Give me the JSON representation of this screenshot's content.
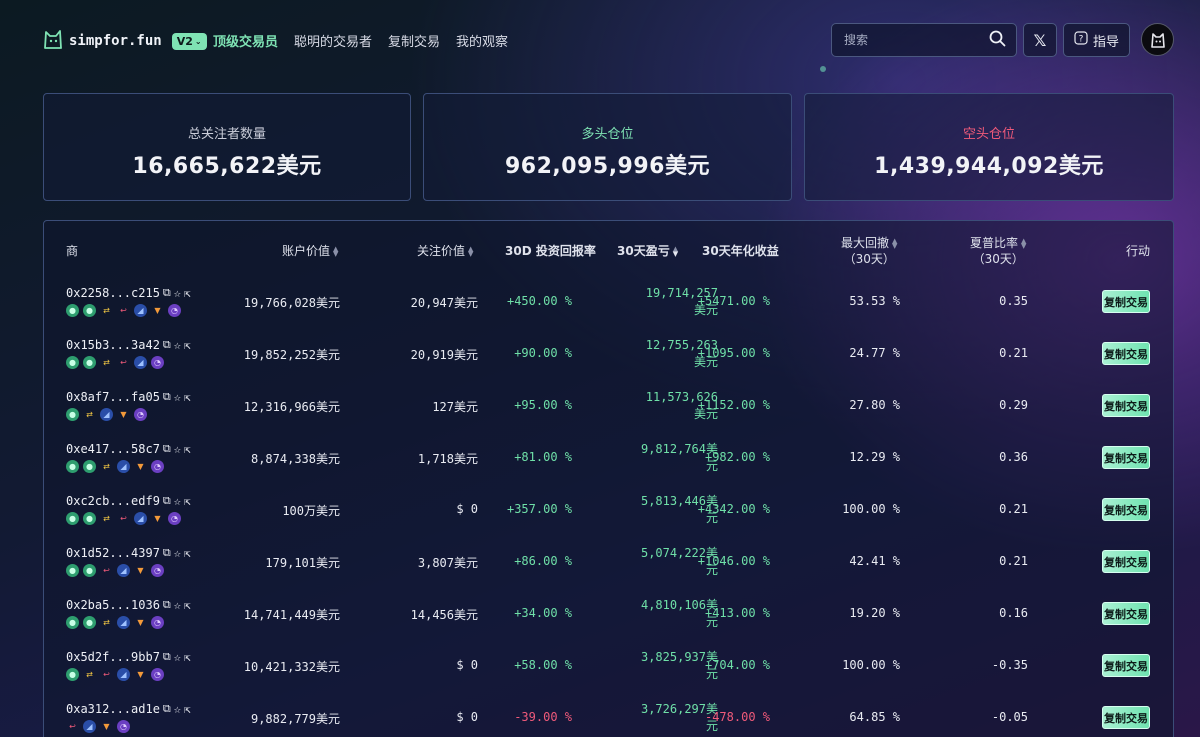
{
  "header": {
    "logo_text": "simpfor.fun",
    "version": "V2",
    "nav": [
      "顶级交易员",
      "聪明的交易者",
      "复制交易",
      "我的观察"
    ],
    "search_placeholder": "搜索",
    "x_label": "𝕏",
    "guide_label": "指导"
  },
  "stats": [
    {
      "label": "总关注者数量",
      "value": "16,665,622美元"
    },
    {
      "label": "多头仓位",
      "value": "962,095,996美元"
    },
    {
      "label": "空头仓位",
      "value": "1,439,944,092美元"
    }
  ],
  "table": {
    "headers": {
      "trader": "商",
      "account_value": "账户价值",
      "follow_value": "关注价值",
      "roi_30d": "30D 投资回报率",
      "pnl_30d": "30天盈亏",
      "apr_30d": "30天年化收益",
      "max_dd_1": "最大回撤",
      "max_dd_2": "（30天）",
      "sharpe_1": "夏普比率",
      "sharpe_2": "（30天）",
      "action": "行动"
    },
    "copy_label": "复制交易",
    "rows": [
      {
        "address": "0x2258...c215",
        "icons": [
          "g",
          "g",
          "y",
          "r",
          "b",
          "o",
          "p"
        ],
        "account_value": "19,766,028美元",
        "follow_value": "20,947美元",
        "roi": "+450.00 %",
        "pnl_1": "19,714,257",
        "pnl_2": "美元",
        "apr": "+5471.00 %",
        "max_dd": "53.53 %",
        "sharpe": "0.35",
        "neg": false
      },
      {
        "address": "0x15b3...3a42",
        "icons": [
          "g",
          "g",
          "y",
          "r",
          "b",
          "p"
        ],
        "account_value": "19,852,252美元",
        "follow_value": "20,919美元",
        "roi": "+90.00 %",
        "pnl_1": "12,755,263",
        "pnl_2": "美元",
        "apr": "+1095.00 %",
        "max_dd": "24.77 %",
        "sharpe": "0.21",
        "neg": false
      },
      {
        "address": "0x8af7...fa05",
        "icons": [
          "g",
          "y",
          "b",
          "o",
          "p"
        ],
        "account_value": "12,316,966美元",
        "follow_value": "127美元",
        "roi": "+95.00 %",
        "pnl_1": "11,573,626",
        "pnl_2": "美元",
        "apr": "+1152.00 %",
        "max_dd": "27.80 %",
        "sharpe": "0.29",
        "neg": false
      },
      {
        "address": "0xe417...58c7",
        "icons": [
          "g",
          "g",
          "y",
          "b",
          "o",
          "p"
        ],
        "account_value": "8,874,338美元",
        "follow_value": "1,718美元",
        "roi": "+81.00 %",
        "pnl_1": "9,812,764美",
        "pnl_2": "元",
        "apr": "+982.00 %",
        "max_dd": "12.29 %",
        "sharpe": "0.36",
        "neg": false
      },
      {
        "address": "0xc2cb...edf9",
        "icons": [
          "g",
          "g",
          "y",
          "r",
          "b",
          "o",
          "p"
        ],
        "account_value": "100万美元",
        "follow_value": "$ 0",
        "roi": "+357.00 %",
        "pnl_1": "5,813,446美",
        "pnl_2": "元",
        "apr": "+4342.00 %",
        "max_dd": "100.00 %",
        "sharpe": "0.21",
        "neg": false
      },
      {
        "address": "0x1d52...4397",
        "icons": [
          "g",
          "g",
          "r",
          "b",
          "o",
          "p"
        ],
        "account_value": "179,101美元",
        "follow_value": "3,807美元",
        "roi": "+86.00 %",
        "pnl_1": "5,074,222美",
        "pnl_2": "元",
        "apr": "+1046.00 %",
        "max_dd": "42.41 %",
        "sharpe": "0.21",
        "neg": false
      },
      {
        "address": "0x2ba5...1036",
        "icons": [
          "g",
          "g",
          "y",
          "b",
          "o",
          "p"
        ],
        "account_value": "14,741,449美元",
        "follow_value": "14,456美元",
        "roi": "+34.00 %",
        "pnl_1": "4,810,106美",
        "pnl_2": "元",
        "apr": "+413.00 %",
        "max_dd": "19.20 %",
        "sharpe": "0.16",
        "neg": false
      },
      {
        "address": "0x5d2f...9bb7",
        "icons": [
          "g",
          "y",
          "r",
          "b",
          "o",
          "p"
        ],
        "account_value": "10,421,332美元",
        "follow_value": "$ 0",
        "roi": "+58.00 %",
        "pnl_1": "3,825,937美",
        "pnl_2": "元",
        "apr": "+704.00 %",
        "max_dd": "100.00 %",
        "sharpe": "-0.35",
        "neg": false
      },
      {
        "address": "0xa312...ad1e",
        "icons": [
          "r",
          "b",
          "o",
          "p"
        ],
        "account_value": "9,882,779美元",
        "follow_value": "$ 0",
        "roi": "-39.00 %",
        "pnl_1": "3,726,297美",
        "pnl_2": "元",
        "apr": "-478.00 %",
        "max_dd": "64.85 %",
        "sharpe": "-0.05",
        "neg": true
      }
    ]
  },
  "colors": {
    "accent": "#7fe3b4",
    "positive": "#6fe0a8",
    "negative": "#f05a7a"
  }
}
